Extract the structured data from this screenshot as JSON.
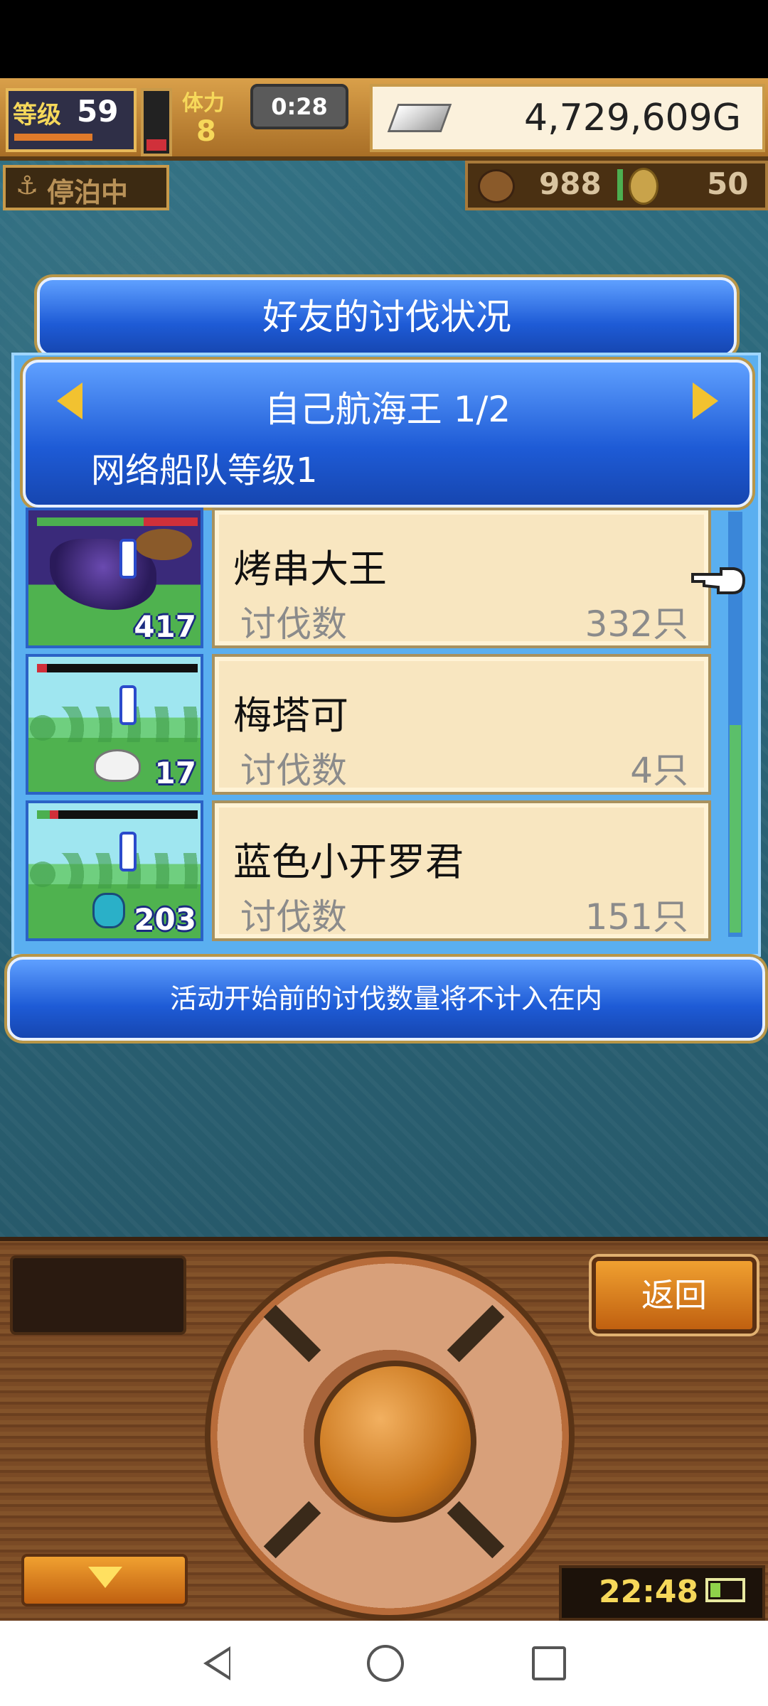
{
  "hud": {
    "level_label": "等级",
    "level_value": "59",
    "stamina_label": "体力",
    "stamina_value": "8",
    "timer": "0:28",
    "gold": "4,729,609G",
    "docked_status": "停泊中",
    "resource_1": "988",
    "resource_2": "50"
  },
  "dialog": {
    "title": "好友的讨伐状况",
    "page_title": "自己航海王 1/2",
    "fleet_level": "网络船队等级1",
    "rows": [
      {
        "name": "烤串大王",
        "label": "讨伐数",
        "count": "332只",
        "kills": "417",
        "hp_color": "#4caf50"
      },
      {
        "name": "梅塔可",
        "label": "讨伐数",
        "count": "4只",
        "kills": "17",
        "hp_color": "#d0303a"
      },
      {
        "name": "蓝色小开罗君",
        "label": "讨伐数",
        "count": "151只",
        "kills": "203",
        "hp_color": "#4caf50"
      }
    ],
    "notice": "活动开始前的讨伐数量将不计入在内"
  },
  "controls": {
    "back_label": "返回",
    "clock": "22:48"
  }
}
